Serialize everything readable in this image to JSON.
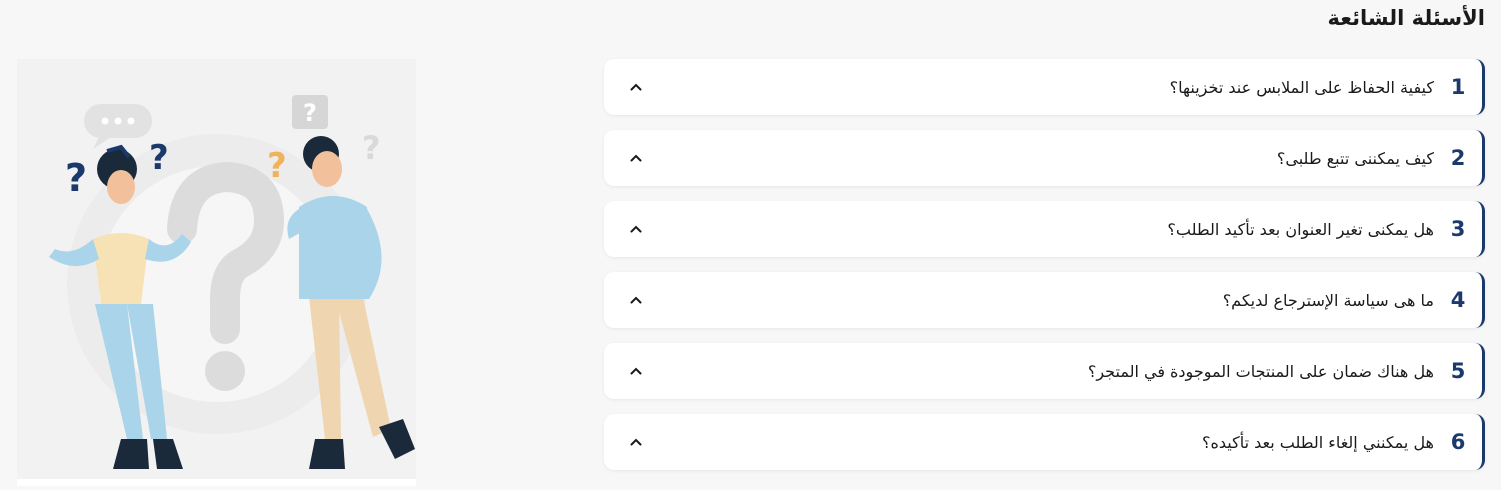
{
  "page": {
    "title": "الأسئلة الشائعة"
  },
  "faq": [
    {
      "num": "1",
      "question": "كيفية الحفاظ على الملابس عند تخزينها؟"
    },
    {
      "num": "2",
      "question": "كيف يمكننى تتبع طلبى؟"
    },
    {
      "num": "3",
      "question": "هل يمكنى تغير العنوان بعد تأكيد الطلب؟"
    },
    {
      "num": "4",
      "question": "ما هى سياسة الإسترجاع لديكم؟"
    },
    {
      "num": "5",
      "question": "هل هناك ضمان على المنتجات الموجودة في المتجر؟"
    },
    {
      "num": "6",
      "question": "هل يمكنني إلغاء الطلب بعد تأكيده؟"
    }
  ],
  "icons": {
    "toggle": "chevron-up-icon"
  },
  "colors": {
    "accent": "#1b3a6b",
    "background": "#f7f7f7",
    "card": "#ffffff"
  }
}
